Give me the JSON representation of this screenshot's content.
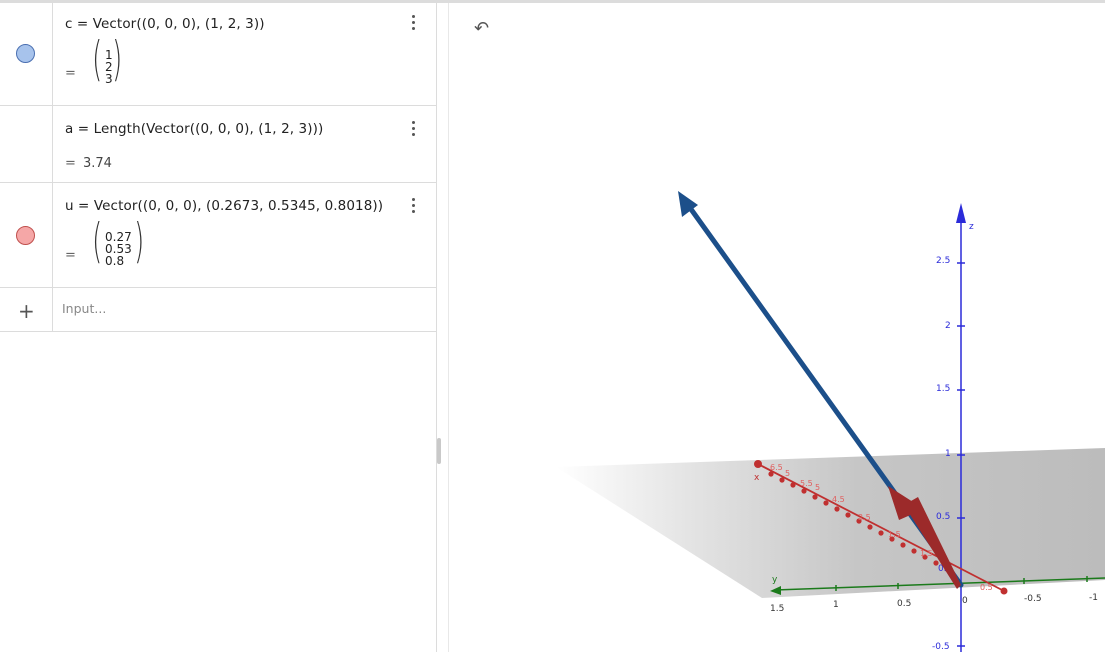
{
  "algebra": {
    "rows": [
      {
        "definition": "c = Vector((0, 0, 0), (1, 2, 3))",
        "result_entries": [
          "1",
          "2",
          "3"
        ],
        "color": "#a7c3ec"
      },
      {
        "definition": "a = Length(Vector((0, 0, 0), (1, 2, 3)))",
        "result": "3.74"
      },
      {
        "definition": "u = Vector((0, 0, 0), (0.2673, 0.5345, 0.8018))",
        "result_entries": [
          "0.27",
          "0.53",
          "0.8"
        ],
        "color": "#f5a7a7"
      }
    ],
    "eq": "=",
    "input_placeholder": "Input..."
  },
  "icons": {
    "undo": "↶",
    "add": "+"
  },
  "graphics": {
    "z_axis_label": "z",
    "x_axis_label": "x",
    "y_axis_label": "y",
    "z_ticks": [
      "2.5",
      "2",
      "1.5",
      "1",
      "0.5",
      "-0.5"
    ],
    "y_ticks": [
      "1.5",
      "1",
      "0.5",
      "0",
      "-0.5",
      "-1"
    ],
    "x_near_label": "0.5",
    "colors": {
      "vector_c": "#1c4f8a",
      "vector_u": "#9c2a2a",
      "z_axis": "#2b2bd9",
      "y_axis": "#1b7a1b",
      "x_axis": "#c03030",
      "plane": "#bdbdbd"
    }
  }
}
